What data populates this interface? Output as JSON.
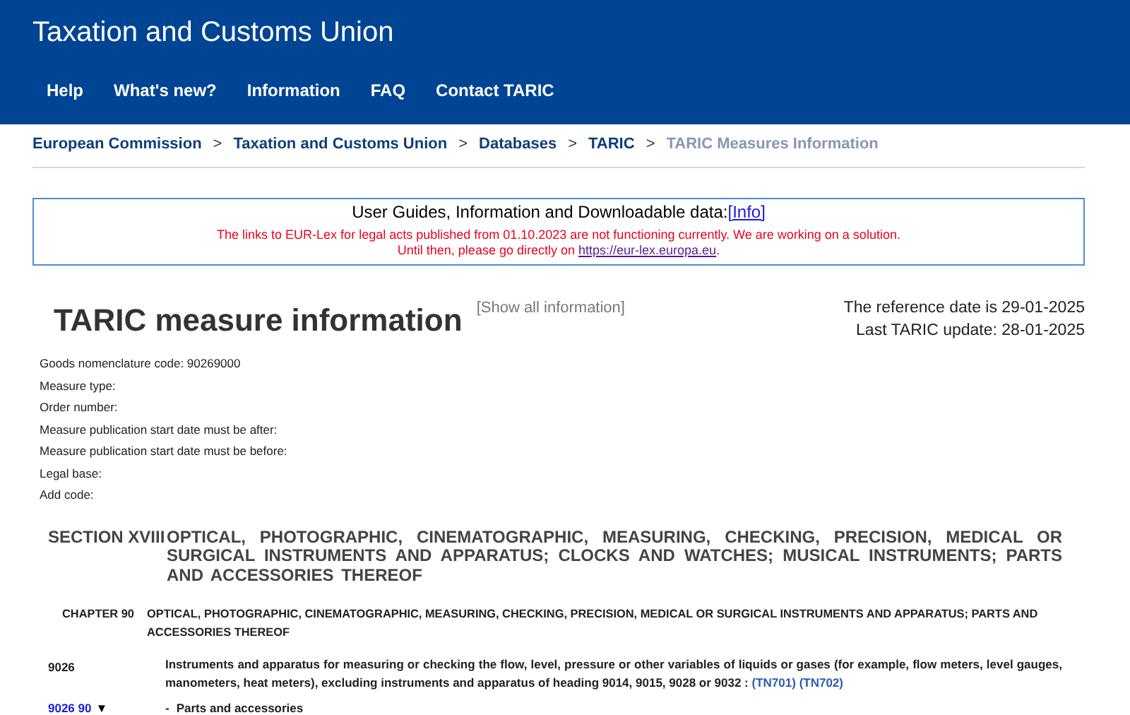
{
  "header": {
    "title": "Taxation and Customs Union"
  },
  "nav": [
    {
      "label": "Help"
    },
    {
      "label": "What's new?"
    },
    {
      "label": "Information"
    },
    {
      "label": "FAQ"
    },
    {
      "label": "Contact TARIC"
    }
  ],
  "breadcrumb": [
    {
      "label": "European Commission",
      "current": false
    },
    {
      "separator": ">",
      "label": "Taxation and Customs Union",
      "current": false
    },
    {
      "separator": ">",
      "label": "Databases",
      "current": false
    },
    {
      "separator": ">",
      "label": "TARIC",
      "current": false
    },
    {
      "separator": ">",
      "label": "TARIC Measures Information",
      "current": true
    }
  ],
  "notice": {
    "heading": "User Guides, Information and Downloadable data:",
    "heading_link": "[Info]",
    "warning": "The links to EUR-Lex for legal acts published from 01.10.2023 are not functioning currently. We are working on a solution.",
    "warning_prefix": "Until then, please go directly on",
    "warning_link": "https://eur-lex.europa.eu",
    "warning_suffix": "."
  },
  "page_title": "TARIC measure information",
  "show_all": "[Show all information]",
  "reference_date": "The reference date is 29-01-2025",
  "last_update": "Last TARIC update:  28-01-2025",
  "filters": [
    {
      "label": "Goods nomenclature code: 90269000"
    },
    {
      "label": "Measure type:"
    },
    {
      "label": "Order number:"
    },
    {
      "label": "Measure publication start date must be after:"
    },
    {
      "label": "Measure publication start date must be before:"
    },
    {
      "label": "Legal base:"
    },
    {
      "label": "Add code:"
    }
  ],
  "section": {
    "label": "SECTION XVIII",
    "text": "OPTICAL, PHOTOGRAPHIC, CINEMATOGRAPHIC, MEASURING, CHECKING, PRECISION, MEDICAL OR SURGICAL INSTRUMENTS AND APPARATUS; CLOCKS AND WATCHES; MUSICAL INSTRUMENTS; PARTS AND ACCESSORIES THEREOF"
  },
  "chapter": {
    "label": "CHAPTER 90",
    "text": "OPTICAL, PHOTOGRAPHIC, CINEMATOGRAPHIC, MEASURING, CHECKING, PRECISION, MEDICAL OR SURGICAL INSTRUMENTS AND APPARATUS; PARTS AND ACCESSORIES THEREOF"
  },
  "heading": {
    "code": "9026",
    "text": "Instruments and apparatus for measuring or checking the flow, level, pressure or other variables of liquids or gases (for example, flow meters, level gauges, manometers, heat meters), excluding instruments and apparatus of heading 9014, 9015, 9028 or 9032 :",
    "notes": [
      "(TN701)",
      "(TN702)"
    ]
  },
  "subheading": {
    "code": "9026 90",
    "arrow": "▼",
    "dash": "-",
    "text": "Parts and accessories"
  }
}
